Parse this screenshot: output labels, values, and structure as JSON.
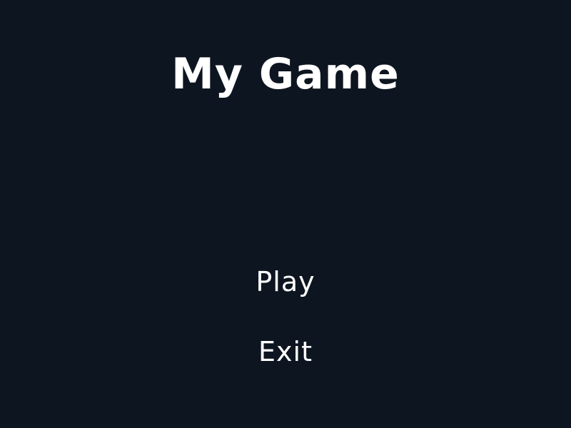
{
  "game": {
    "title": "My Game"
  },
  "menu": {
    "items": [
      {
        "label": "Play"
      },
      {
        "label": "Exit"
      }
    ]
  },
  "colors": {
    "background": "#0d1520",
    "text": "#ffffff"
  }
}
